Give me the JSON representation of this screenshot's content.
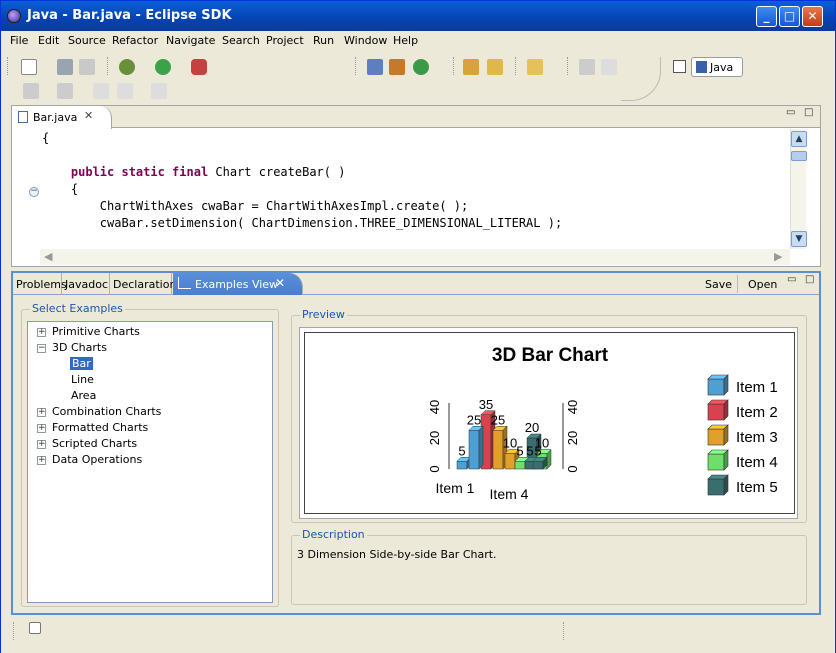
{
  "window": {
    "title": "Java - Bar.java - Eclipse SDK"
  },
  "menu": [
    "File",
    "Edit",
    "Source",
    "Refactor",
    "Navigate",
    "Search",
    "Project",
    "Run",
    "Window",
    "Help"
  ],
  "perspective": {
    "label": "Java"
  },
  "editor": {
    "tab_label": "Bar.java",
    "lines": [
      "{",
      "",
      "    public static final Chart createBar( )",
      "    {",
      "        ChartWithAxes cwaBar = ChartWithAxesImpl.create( );",
      "        cwaBar.setDimension( ChartDimension.THREE_DIMENSIONAL_LITERAL );"
    ]
  },
  "bottom_tabs": [
    "Problems",
    "Javadoc",
    "Declaration",
    "Examples View"
  ],
  "bottom_actions": {
    "save": "Save",
    "open": "Open"
  },
  "select_examples": {
    "label": "Select Examples",
    "tree": [
      {
        "label": "Primitive Charts",
        "expander": "+"
      },
      {
        "label": "3D Charts",
        "expander": "-"
      },
      {
        "label": "Bar",
        "selected": true
      },
      {
        "label": "Line"
      },
      {
        "label": "Area"
      },
      {
        "label": "Combination Charts",
        "expander": "+"
      },
      {
        "label": "Formatted Charts",
        "expander": "+"
      },
      {
        "label": "Scripted Charts",
        "expander": "+"
      },
      {
        "label": "Data Operations",
        "expander": "+"
      }
    ]
  },
  "preview": {
    "label": "Preview"
  },
  "description": {
    "label": "Description",
    "text": "3 Dimension Side-by-side Bar Chart."
  },
  "chart_data": {
    "type": "bar",
    "title": "3D Bar Chart",
    "categories": [
      "Item 1",
      "Item 2",
      "Item 3",
      "Item 4",
      "Item 5"
    ],
    "values": [
      5,
      25,
      35,
      25,
      10,
      5,
      20,
      10,
      5,
      5
    ],
    "legend": [
      "Item 1",
      "Item 2",
      "Item 3",
      "Item 4",
      "Item 5"
    ],
    "legend_position": "right",
    "x_tick_labels": [
      "Item 1",
      "Item 4"
    ],
    "y_ticks": [
      "0",
      "20",
      "40"
    ],
    "ylim": [
      0,
      40
    ],
    "colors": [
      "#4e9fd2",
      "#d9414f",
      "#e0a02a",
      "#6de06a",
      "#3a6d6d"
    ]
  }
}
